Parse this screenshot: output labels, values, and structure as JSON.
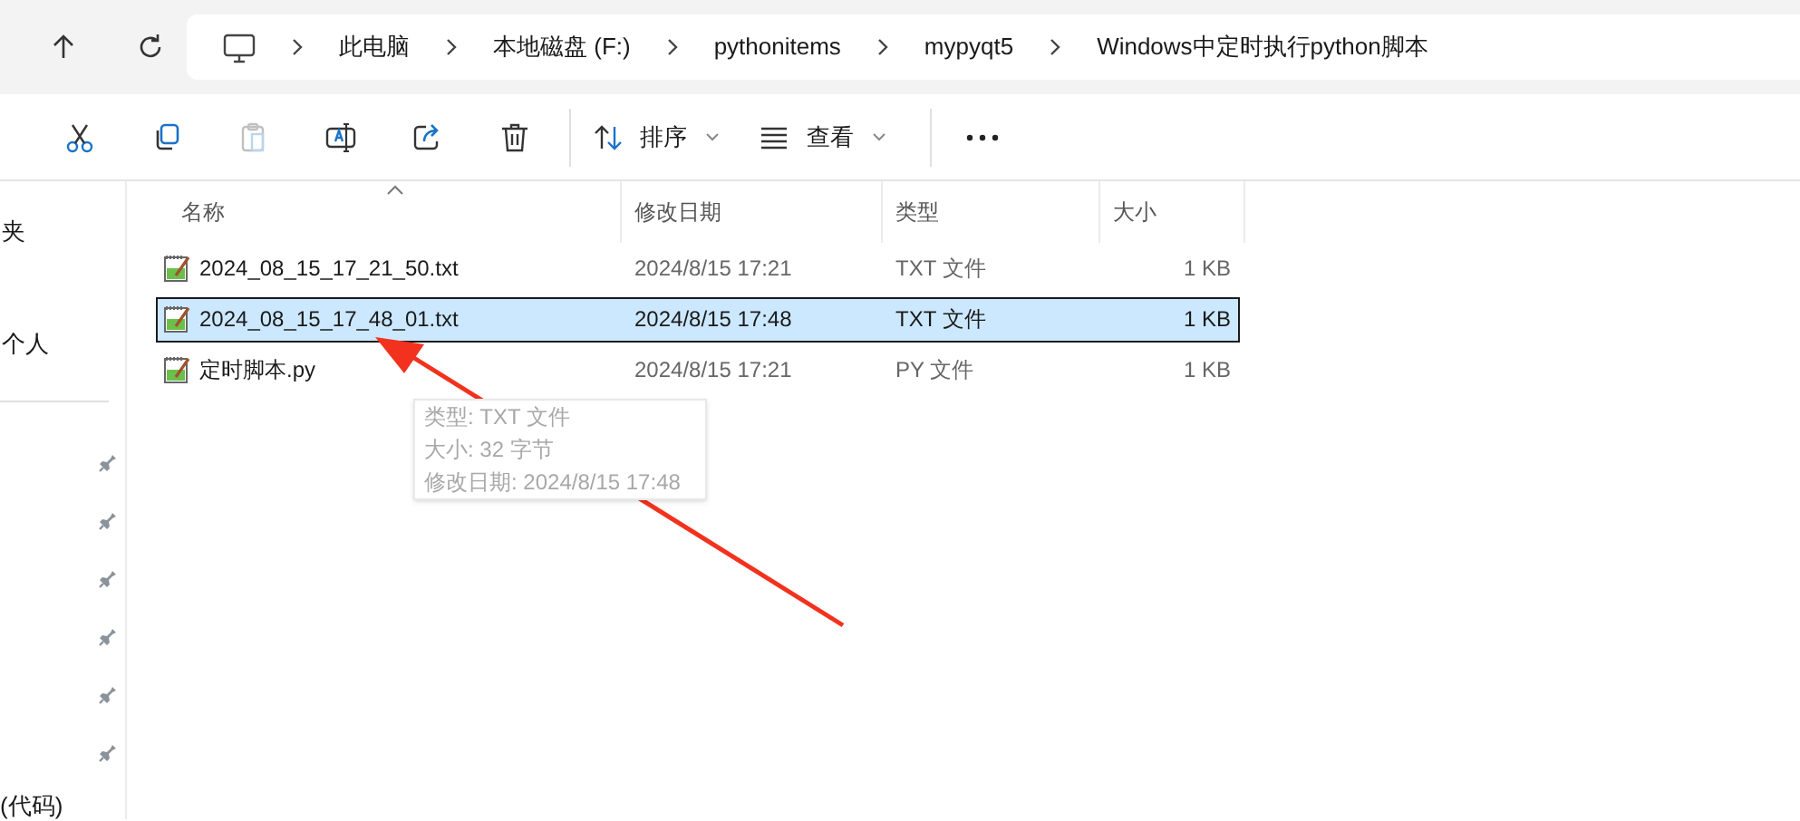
{
  "nav_buttons": [
    {
      "kind": "up"
    },
    {
      "kind": "refresh"
    }
  ],
  "breadcrumbs": [
    "此电脑",
    "本地磁盘 (F:)",
    "pythonitems",
    "mypyqt5",
    "Windows中定时执行python脚本"
  ],
  "toolbar": [
    {
      "kind": "cut",
      "disabled": false
    },
    {
      "kind": "copy",
      "disabled": false
    },
    {
      "kind": "paste",
      "disabled": true
    },
    {
      "kind": "rename",
      "disabled": false
    },
    {
      "kind": "share",
      "disabled": false
    },
    {
      "kind": "delete",
      "disabled": false
    }
  ],
  "menus": [
    {
      "kind": "sort",
      "label": "排序"
    },
    {
      "kind": "view",
      "label": "查看"
    }
  ],
  "nav_pane": {
    "top_items": [
      "夹",
      "个人"
    ],
    "pinned_rows": [
      {
        "pinned": true
      },
      {
        "pinned": true
      },
      {
        "pinned": true
      },
      {
        "pinned": true
      },
      {
        "pinned": true
      },
      {
        "pinned": true
      }
    ],
    "bottom_item": "(代码)"
  },
  "columns": [
    "名称",
    "修改日期",
    "类型",
    "大小"
  ],
  "files": [
    {
      "name": "2024_08_15_17_21_50.txt",
      "modified": "2024/8/15 17:21",
      "type": "TXT 文件",
      "size": "1 KB",
      "selected": false
    },
    {
      "name": "2024_08_15_17_48_01.txt",
      "modified": "2024/8/15 17:48",
      "type": "TXT 文件",
      "size": "1 KB",
      "selected": true
    },
    {
      "name": "定时脚本.py",
      "modified": "2024/8/15 17:21",
      "type": "PY 文件",
      "size": "1 KB",
      "selected": false
    }
  ],
  "tooltip": [
    "类型: TXT 文件",
    "大小: 32 字节",
    "修改日期: 2024/8/15 17:48"
  ]
}
